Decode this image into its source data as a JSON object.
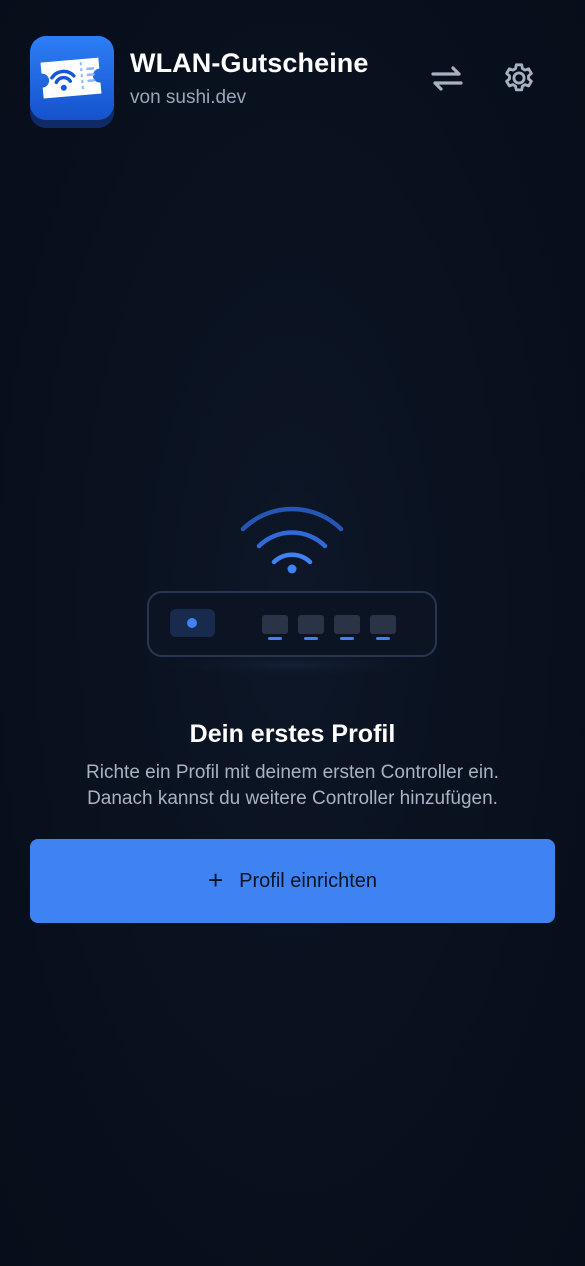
{
  "header": {
    "app_title": "WLAN-Gutscheine",
    "app_subtitle": "von sushi.dev",
    "app_icon": "wifi-ticket-icon",
    "switch_icon": "swap-arrows-icon",
    "settings_icon": "gear-icon"
  },
  "empty_state": {
    "illustration": "router-wifi-illustration",
    "title": "Dein erstes Profil",
    "description_line1": "Richte ein Profil mit deinem ersten Controller ein.",
    "description_line2": "Danach kannst du weitere Controller hinzufügen.",
    "button_icon": "+",
    "button_label": "Profil einrichten"
  },
  "colors": {
    "background": "#070d19",
    "accent": "#3f82f2",
    "text_primary": "#ffffff",
    "text_secondary": "#a8b2c2"
  }
}
